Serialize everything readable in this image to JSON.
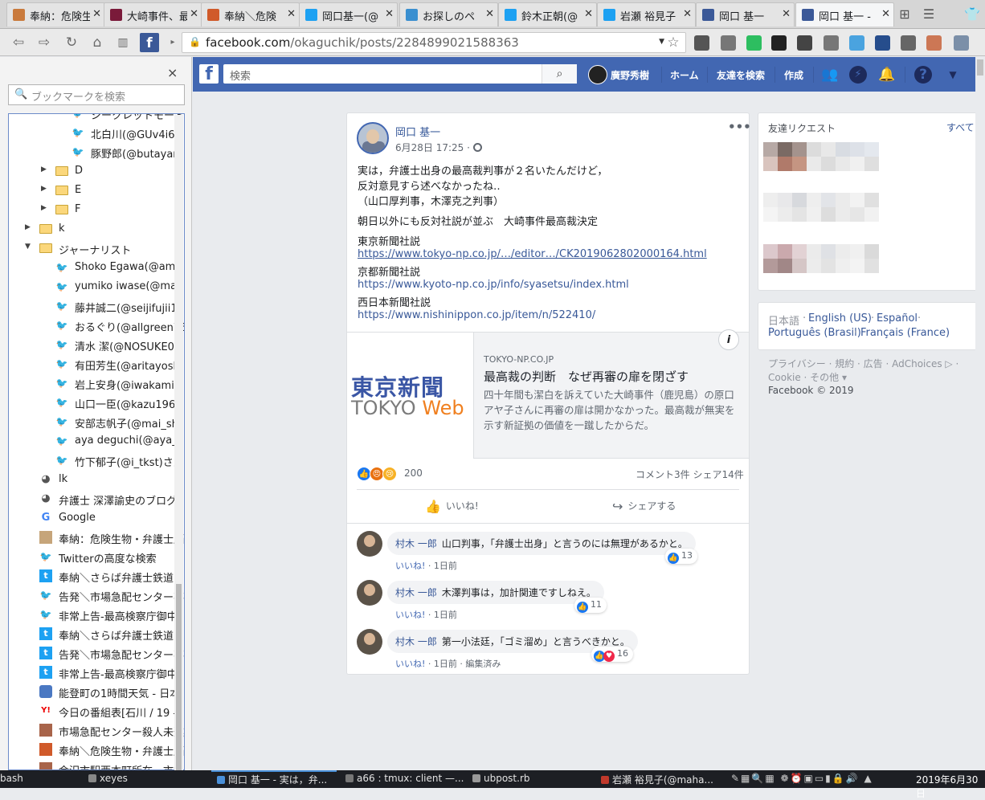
{
  "browser": {
    "tabs": [
      {
        "label": "奉納：危険生",
        "icon": "#c97a3c",
        "active": false
      },
      {
        "label": "大崎事件、最",
        "icon": "#7a1a3a",
        "active": false
      },
      {
        "label": "奉納＼危険",
        "icon": "#d05a2a",
        "active": false
      },
      {
        "label": "岡口基一(@",
        "icon": "#1da1f2",
        "active": false
      },
      {
        "label": "お探しのペ",
        "icon": "#3a8fd0",
        "active": false
      },
      {
        "label": "鈴木正朝(@",
        "icon": "#1da1f2",
        "active": false
      },
      {
        "label": "岩瀬 裕見子",
        "icon": "#1da1f2",
        "active": false
      },
      {
        "label": "岡口 基一",
        "icon": "#3b5998",
        "active": false
      },
      {
        "label": "岡口 基一 -",
        "icon": "#3b5998",
        "active": true
      }
    ],
    "url_host": "facebook.com",
    "url_path": "/okaguchik/posts/2284899021588363"
  },
  "sidebar": {
    "search_placeholder": "ブックマークを検索",
    "close": "×",
    "items": [
      {
        "label": "シークレットモード",
        "type": "twitter",
        "indent": 4,
        "partial": true
      },
      {
        "label": "北白川(@GUv4i6)",
        "type": "twitter",
        "indent": 4
      },
      {
        "label": "豚野郎(@butayan",
        "type": "twitter",
        "indent": 4
      },
      {
        "label": "D",
        "type": "folder",
        "indent": 3
      },
      {
        "label": "E",
        "type": "folder",
        "indent": 3
      },
      {
        "label": "F",
        "type": "folder",
        "indent": 3
      },
      {
        "label": "k",
        "type": "folder",
        "indent": 2
      },
      {
        "label": "ジャーナリスト",
        "type": "folder-open",
        "indent": 2
      },
      {
        "label": "Shoko Egawa(@amn",
        "type": "twitter",
        "indent": 3
      },
      {
        "label": "yumiko iwase(@mah",
        "type": "twitter",
        "indent": 3
      },
      {
        "label": "藤井誠二(@seijifujii19",
        "type": "twitter",
        "indent": 3
      },
      {
        "label": "おるぐり(@allgreen76",
        "type": "twitter",
        "indent": 3
      },
      {
        "label": "清水 潔(@NOSUKE06",
        "type": "twitter",
        "indent": 3
      },
      {
        "label": "有田芳生(@aritayosh",
        "type": "twitter",
        "indent": 3
      },
      {
        "label": "岩上安身(@iwakamiy",
        "type": "twitter",
        "indent": 3
      },
      {
        "label": "山口一臣(@kazu1961",
        "type": "twitter",
        "indent": 3
      },
      {
        "label": "安部志帆子(@mai_sh",
        "type": "twitter",
        "indent": 3
      },
      {
        "label": "aya deguchi(@aya_d",
        "type": "twitter",
        "indent": 3
      },
      {
        "label": "竹下郁子(@i_tkst)さん",
        "type": "twitter",
        "indent": 3
      },
      {
        "label": "lk",
        "type": "globe",
        "indent": 2
      },
      {
        "label": "弁護士 深澤諭史のブログ",
        "type": "globe",
        "indent": 2
      },
      {
        "label": "Google",
        "type": "google",
        "indent": 2
      },
      {
        "label": "奉納：危険生物・弁護士脳",
        "type": "site",
        "indent": 2
      },
      {
        "label": "Twitterの高度な検索",
        "type": "twitter",
        "indent": 2
      },
      {
        "label": "奉納＼さらば弁護士鉄道",
        "type": "tblue",
        "indent": 2
      },
      {
        "label": "告発＼市場急配センター事",
        "type": "twitter",
        "indent": 2
      },
      {
        "label": "非常上告-最高検察庁御中",
        "type": "twitter",
        "indent": 2
      },
      {
        "label": "奉納＼さらば弁護士鉄道",
        "type": "tblue",
        "indent": 2
      },
      {
        "label": "告発＼市場急配センター事",
        "type": "tblue",
        "indent": 2
      },
      {
        "label": "非常上告-最高検察庁御中",
        "type": "tblue",
        "indent": 2
      },
      {
        "label": "能登町の1時間天気 - 日本",
        "type": "weather",
        "indent": 2
      },
      {
        "label": "今日の番組表[石川 / 19 -",
        "type": "yahoo",
        "indent": 2
      },
      {
        "label": "市場急配センター殺人未遂",
        "type": "photo",
        "indent": 2
      },
      {
        "label": "奉納＼危険生物・弁護士脳",
        "type": "photo2",
        "indent": 2
      },
      {
        "label": "金沢市駅西本町所在、市場",
        "type": "photo",
        "indent": 2,
        "partial": true
      }
    ]
  },
  "fb": {
    "search_placeholder": "検索",
    "user_name": "廣野秀樹",
    "nav_home": "ホーム",
    "nav_find_friends": "友達を検索",
    "nav_create": "作成",
    "logo": "f",
    "post": {
      "author": "岡口 基一",
      "time": "6月28日 17:25 · ",
      "lines": [
        "実は，弁護士出身の最高裁判事が２名いたんだけど，",
        "反対意見すら述べなかったね‥",
        "（山口厚判事，木澤克之判事）",
        "朝日以外にも反対社説が並ぶ　大崎事件最高裁決定",
        "東京新聞社説",
        "https://www.tokyo-np.co.jp/…/editor…/CK2019062802000164.html",
        "京都新聞社説",
        "https://www.kyoto-np.co.jp/info/syasetsu/index.html",
        "西日本新聞社説",
        "https://www.nishinippon.co.jp/item/n/522410/"
      ],
      "preview": {
        "logo_line1": "東京新聞",
        "logo_line2a": "TOKYO ",
        "logo_line2b": "Web",
        "source": "TOKYO-NP.CO.JP",
        "title": "最高裁の判断　なぜ再審の扉を閉ざす",
        "desc": "四十年間も潔白を訴えていた大崎事件（鹿児島）の原口アヤ子さんに再審の扉は開かなかった。最高裁が無実を示す新証拠の価値を一蹴したからだ。",
        "info": "i"
      },
      "reaction_count": "200",
      "stats": "コメント3件  シェア14件",
      "like_button": "いいね!",
      "share_button": "シェアする",
      "comments": [
        {
          "name": "村木 一郎",
          "text": "山口判事，「弁護士出身」と言うのには無理があるかと。",
          "like": "いいね!",
          "time": " · 1日前",
          "edited": "",
          "count": "13",
          "heart": false
        },
        {
          "name": "村木 一郎",
          "text": "木澤判事は，加計関連ですしねえ。",
          "like": "いいね!",
          "time": " · 1日前",
          "edited": "",
          "count": "11",
          "heart": false
        },
        {
          "name": "村木 一郎",
          "text": "第一小法廷，「ゴミ溜め」と言うべきかと。",
          "like": "いいね!",
          "time": " · 1日前",
          "edited": " · 編集済み",
          "count": "16",
          "heart": true
        }
      ]
    },
    "right": {
      "friend_requests": "友達リクエスト",
      "see_all": "すべて",
      "languages": [
        "日本語",
        "English (US)",
        "Español",
        "Português (Brasil)",
        "Français (France)"
      ],
      "footer_links": "プライバシー · 規約 · 広告 · AdChoices ▷ · Cookie · その他 ▾",
      "copyright": "Facebook © 2019"
    }
  },
  "taskbar": {
    "items": [
      "bash",
      "xeyes",
      "岡口 基一 - 実は，弁...",
      "a66 : tmux: client —...",
      "ubpost.rb",
      "岩瀬 裕見子(@maha..."
    ],
    "clock": "2019年6月30日"
  }
}
